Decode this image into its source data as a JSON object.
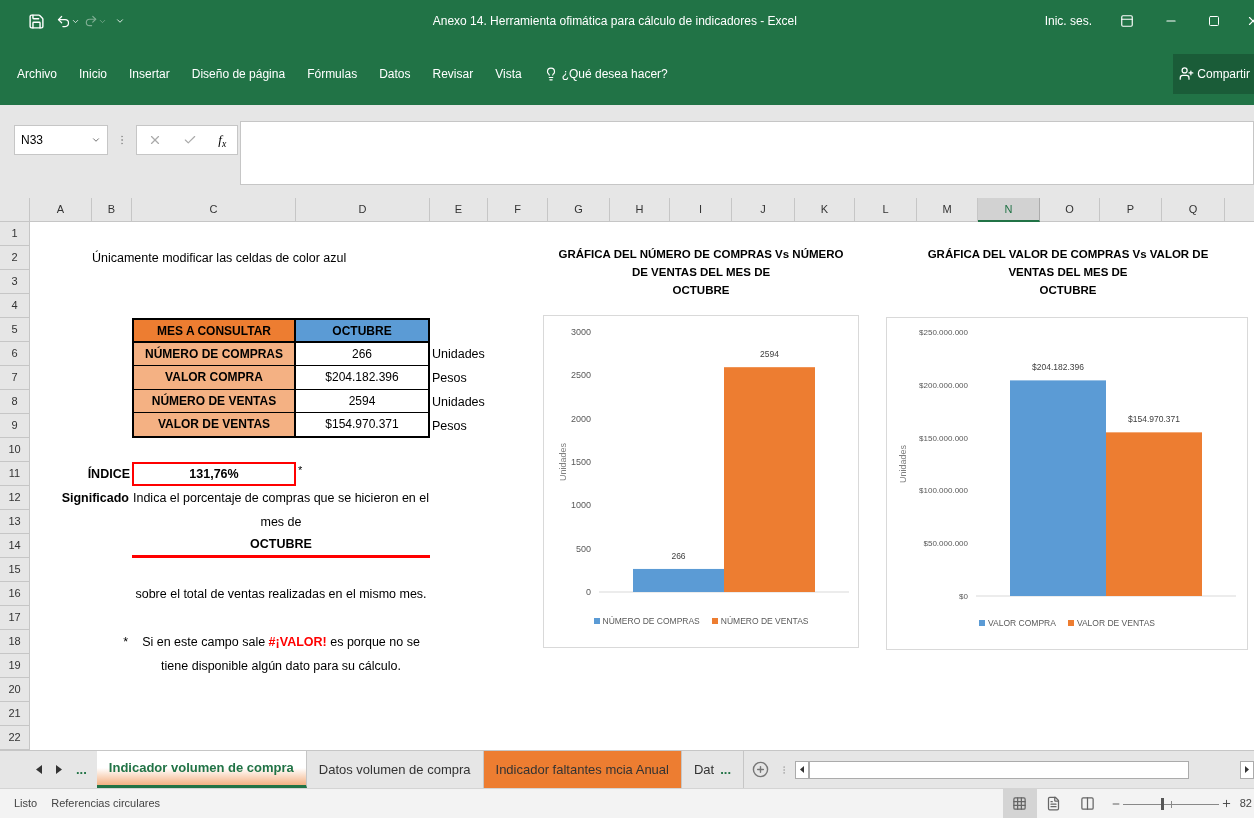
{
  "title_bar": {
    "title": "Anexo 14. Herramienta ofimática para cálculo de indicadores  -  Excel",
    "sign_in": "Inic. ses."
  },
  "ribbon_tabs": [
    "Archivo",
    "Inicio",
    "Insertar",
    "Diseño de página",
    "Fórmulas",
    "Datos",
    "Revisar",
    "Vista"
  ],
  "tell_me": "¿Qué desea hacer?",
  "share": "Compartir",
  "formula_bar": {
    "name_box": "N33",
    "function_label": "f$_{x}$"
  },
  "columns": [
    {
      "label": "A",
      "selected": false
    },
    {
      "label": "B",
      "selected": false
    },
    {
      "label": "C",
      "selected": false
    },
    {
      "label": "D",
      "selected": false
    },
    {
      "label": "E",
      "selected": false
    },
    {
      "label": "F",
      "selected": false
    },
    {
      "label": "G",
      "selected": false
    },
    {
      "label": "H",
      "selected": false
    },
    {
      "label": "I",
      "selected": false
    },
    {
      "label": "J",
      "selected": false
    },
    {
      "label": "K",
      "selected": false
    },
    {
      "label": "L",
      "selected": false
    },
    {
      "label": "M",
      "selected": false
    },
    {
      "label": "N",
      "selected": true
    },
    {
      "label": "O",
      "selected": false
    },
    {
      "label": "P",
      "selected": false
    },
    {
      "label": "Q",
      "selected": false
    }
  ],
  "rows": [
    "1",
    "2",
    "3",
    "4",
    "5",
    "6",
    "7",
    "8",
    "9",
    "10",
    "11",
    "12",
    "13",
    "14",
    "15",
    "16",
    "17",
    "18",
    "19",
    "20",
    "21",
    "22"
  ],
  "sheet": {
    "instruction": "Únicamente modificar las celdas de color azul",
    "table": {
      "header": {
        "label": "MES A CONSULTAR",
        "value": "OCTUBRE"
      },
      "rows": [
        {
          "label": "NÚMERO DE COMPRAS",
          "value": "266",
          "unit": "Unidades"
        },
        {
          "label": "VALOR COMPRA",
          "value": "$204.182.396",
          "unit": "Pesos"
        },
        {
          "label": "NÚMERO DE VENTAS",
          "value": "2594",
          "unit": "Unidades"
        },
        {
          "label": "VALOR DE VENTAS",
          "value": "$154.970.371",
          "unit": "Pesos"
        }
      ]
    },
    "index": {
      "label": "ÍNDICE",
      "value": "131,76%",
      "marker": "*"
    },
    "meaning": {
      "label": "Significado",
      "text": "Indica el porcentaje de compras que se hicieron en el mes de",
      "month": "OCTUBRE",
      "continuation": "sobre el total de ventas realizadas en el mismo mes."
    },
    "note": {
      "marker": "*",
      "before": "Si en este campo sale",
      "highlight": "#¡VALOR!",
      "after": "es porque no se tiene disponible algún dato para su cálculo."
    }
  },
  "charts": [
    {
      "chart_data": {
        "type": "bar",
        "title": "GRÁFICA DEL NÚMERO DE COMPRAS Vs NÚMERO\nDE VENTAS DEL MES DE\nOCTUBRE",
        "ylabel": "Unidades",
        "legend": "bottom",
        "ylim": [
          0,
          3000
        ],
        "yticks": [
          0,
          500,
          1000,
          1500,
          2000,
          2500,
          3000
        ],
        "data_labels": true,
        "series": [
          {
            "name": "NÚMERO DE COMPRAS",
            "color": "#5b9bd5",
            "values": [
              266
            ]
          },
          {
            "name": "NÚMERO DE VENTAS",
            "color": "#ed7d31",
            "values": [
              2594
            ]
          }
        ]
      }
    },
    {
      "chart_data": {
        "type": "bar",
        "title": "GRÁFICA DEL VALOR DE COMPRAS Vs VALOR DE\nVENTAS DEL MES DE\nOCTUBRE",
        "ylabel": "Unidades",
        "legend": "bottom",
        "ylim": [
          0,
          250000000
        ],
        "yticks": [
          {
            "value": 0,
            "label": "$0"
          },
          {
            "value": 50000000,
            "label": "$50.000.000"
          },
          {
            "value": 100000000,
            "label": "$100.000.000"
          },
          {
            "value": 150000000,
            "label": "$150.000.000"
          },
          {
            "value": 200000000,
            "label": "$200.000.000"
          },
          {
            "value": 250000000,
            "label": "$250.000.000"
          }
        ],
        "value_labels": [
          "$204.182.396",
          "$154.970.371"
        ],
        "series": [
          {
            "name": "VALOR COMPRA",
            "color": "#5b9bd5",
            "values": [
              204182396
            ]
          },
          {
            "name": "VALOR DE VENTAS",
            "color": "#ed7d31",
            "values": [
              154970371
            ]
          }
        ]
      }
    }
  ],
  "sheet_nav": {
    "more": "..."
  },
  "sheet_tabs": [
    {
      "label": "Indicador volumen de compra",
      "selected": true,
      "color": "#f4b183"
    },
    {
      "label": "Datos volumen de compra",
      "selected": false
    },
    {
      "label": "Indicador faltantes mcia Anual",
      "selected": false,
      "color": "#ed7d31"
    },
    {
      "label": "Dat",
      "selected": false
    }
  ],
  "tabs_overflow": "...",
  "status_bar": {
    "items": [
      "Listo",
      "Referencias circulares"
    ],
    "views": [
      {
        "kind": "normal",
        "selected": true
      },
      {
        "kind": "page_layout",
        "selected": false
      },
      {
        "kind": "page_break",
        "selected": false
      }
    ],
    "zoom": {
      "level": 0.41,
      "reading": "82"
    }
  }
}
